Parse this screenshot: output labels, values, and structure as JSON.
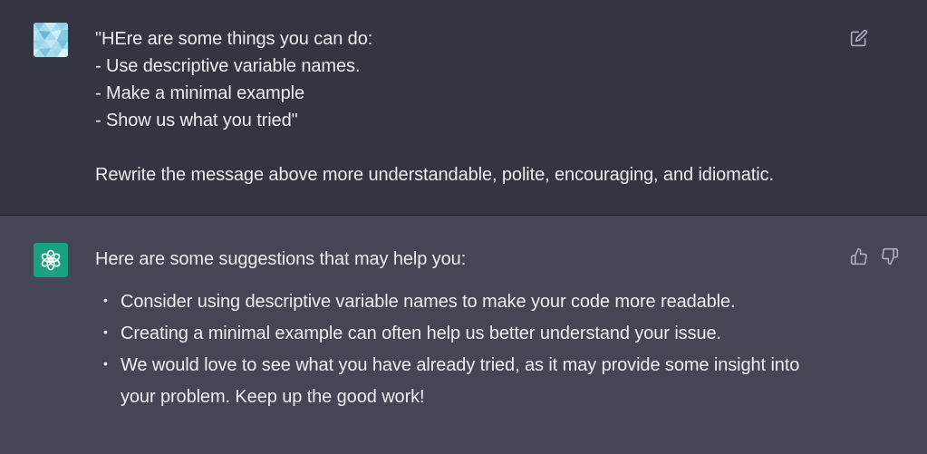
{
  "conversation": {
    "user_turn": {
      "avatar_icon": "user-avatar-pattern",
      "lines": [
        "\"HEre are some things you can do:",
        "- Use descriptive variable names.",
        "- Make a minimal example",
        "- Show us what you tried\"",
        "Rewrite the message above more understandable, polite, encouraging, and idiomatic."
      ],
      "edit_icon": "edit-icon"
    },
    "assistant_turn": {
      "avatar_icon": "openai-logo-icon",
      "avatar_color": "#19a27f",
      "intro": "Here are some suggestions that may help you:",
      "bullets": [
        "Consider using descriptive variable names to make your code more readable.",
        "Creating a minimal example can often help us better understand your issue.",
        "We would love to see what you have already tried, as it may provide some insight into your problem. Keep up the good work!"
      ],
      "feedback_icons": [
        "thumbs-up-icon",
        "thumbs-down-icon"
      ]
    }
  },
  "colors": {
    "user_bg": "#343541",
    "assistant_bg": "#444654",
    "text": "#ececf1",
    "icon": "#acacbe"
  }
}
